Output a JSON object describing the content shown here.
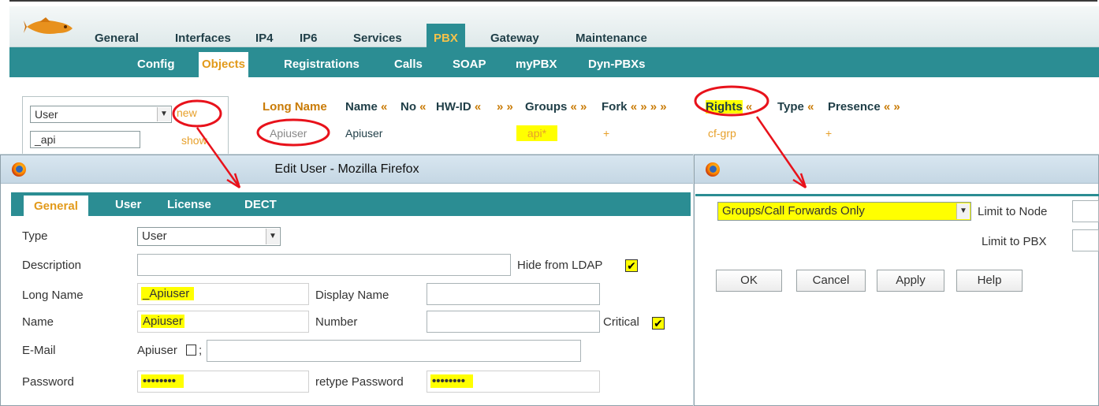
{
  "background": {
    "main_tabs": [
      "General",
      "Interfaces",
      "IP4",
      "IP6",
      "Services",
      "PBX",
      "Gateway",
      "Maintenance"
    ],
    "active_main_tab": "PBX",
    "sub_tabs": [
      "Config",
      "Objects",
      "Registrations",
      "Calls",
      "SOAP",
      "myPBX",
      "Dyn-PBXs"
    ],
    "active_sub_tab": "Objects",
    "object_type_select": "User",
    "new_link": "new",
    "filter_value": "_api",
    "show_link": "show",
    "columns": {
      "long_name": "Long Name",
      "name": "Name",
      "name_sort": "«",
      "no": "No",
      "no_sort": "«",
      "hwid": "HW-ID",
      "hwid_sort": "«",
      "extra_sort": "» »",
      "groups": "Groups",
      "groups_sort": "« »",
      "fork": "Fork",
      "fork_sort": "« » » »",
      "rights": "Rights",
      "rights_sort": "«",
      "type": "Type",
      "type_sort": "«",
      "presence": "Presence",
      "presence_sort": "« »"
    },
    "row": {
      "long_name": "Apiuser",
      "name": "Apiuser",
      "groups": "api*",
      "fork": "+",
      "rights": "cf-grp",
      "presence": "+"
    }
  },
  "edit_user_dialog": {
    "title": "Edit User - Mozilla Firefox",
    "tabs": [
      "General",
      "User",
      "License",
      "DECT"
    ],
    "active_tab": "General",
    "type_label": "Type",
    "type_value": "User",
    "description_label": "Description",
    "description_value": "",
    "hide_ldap_label": "Hide from LDAP",
    "hide_ldap_checked": true,
    "long_name_label": "Long Name",
    "long_name_value": "_Apiuser",
    "display_name_label": "Display Name",
    "display_name_value": "",
    "name_label": "Name",
    "name_value": "Apiuser",
    "number_label": "Number",
    "number_value": "",
    "critical_label": "Critical",
    "critical_checked": true,
    "email_label": "E-Mail",
    "email_prefix": "Apiuser",
    "email_separator": ";",
    "email_value": "",
    "password_label": "Password",
    "password_value": "••••••••",
    "retype_password_label": "retype Password",
    "retype_password_value": "••••••••"
  },
  "rights_dialog": {
    "title": "",
    "rights_select": "Groups/Call Forwards Only",
    "limit_node_label": "Limit to Node",
    "limit_node_value": "",
    "limit_pbx_label": "Limit to PBX",
    "limit_pbx_value": "",
    "ok_label": "OK",
    "cancel_label": "Cancel",
    "apply_label": "Apply",
    "help_label": "Help"
  },
  "colors": {
    "teal": "#2b8d93",
    "orange": "#e29a1b",
    "highlight": "#ffff00",
    "annotation": "#e8121b"
  },
  "icons": [
    "fish-logo-icon",
    "firefox-icon",
    "chevron-down-icon",
    "checkmark-icon"
  ]
}
